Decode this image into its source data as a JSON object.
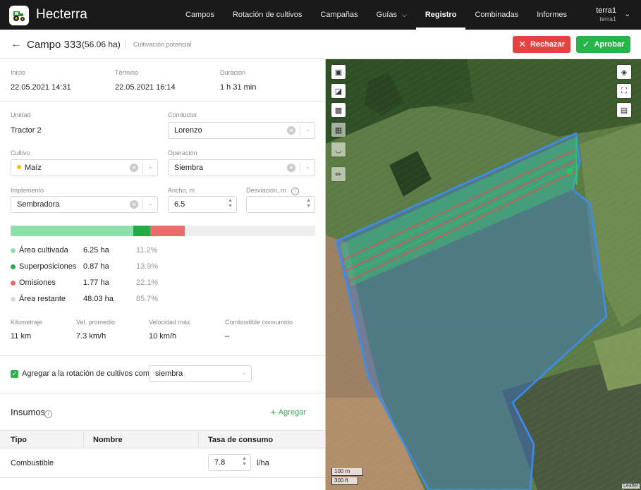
{
  "app": {
    "name": "Hecterra",
    "logo_icon": "tractor-icon"
  },
  "nav": {
    "items": [
      {
        "label": "Campos",
        "active": false
      },
      {
        "label": "Rotación de cultivos",
        "active": false
      },
      {
        "label": "Campañas",
        "active": false
      },
      {
        "label": "Guías",
        "active": false,
        "chevron": true
      },
      {
        "label": "Registro",
        "active": true
      },
      {
        "label": "Combinadas",
        "active": false
      },
      {
        "label": "Informes",
        "active": false
      }
    ],
    "user": {
      "name": "terra1",
      "account": "terra1"
    }
  },
  "header": {
    "title": "Campo 333",
    "area": "(56.06 ha)",
    "subtitle": "Cultivación potencial",
    "reject_label": "Rechazar",
    "approve_label": "Aprobar"
  },
  "times": {
    "start_label": "Inicio",
    "start": "22.05.2021 14:31",
    "end_label": "Término",
    "end": "22.05.2021 16:14",
    "duration_label": "Duración",
    "duration": "1 h 31 min"
  },
  "form": {
    "unit_label": "Unidad",
    "unit": "Tractor 2",
    "driver_label": "Conductor",
    "driver": "Lorenzo",
    "crop_label": "Cultivo",
    "crop": "Maíz",
    "operation_label": "Operación",
    "operation": "Siembra",
    "implement_label": "Implemento",
    "implement": "Sembradora",
    "width_label": "Ancho, m",
    "width": "6.5",
    "deviation_label": "Desviación, m",
    "deviation": ""
  },
  "coverage": {
    "items": [
      {
        "name": "Área cultivada",
        "value": "6.25 ha",
        "pct": "11.2%",
        "fraction": 0.112,
        "color": "#8ee0aa"
      },
      {
        "name": "Superposiciones",
        "value": "0.87 ha",
        "pct": "13.9%",
        "fraction": 0.0155,
        "color": "#1fad45"
      },
      {
        "name": "Omisiones",
        "value": "1.77 ha",
        "pct": "22.1%",
        "fraction": 0.0316,
        "color": "#ee6b6b"
      },
      {
        "name": "Área restante",
        "value": "48.03 ha",
        "pct": "85.7%",
        "fraction": 0.857,
        "color": "#dcdcdc"
      }
    ]
  },
  "stats": {
    "mileage_label": "Kilometraje",
    "mileage": "11 km",
    "avg_speed_label": "Vel. promedio",
    "avg_speed": "7.3 km/h",
    "max_speed_label": "Velocidad máx.",
    "max_speed": "10 km/h",
    "fuel_label": "Combustible consumido",
    "fuel": "–"
  },
  "rotation": {
    "checked": true,
    "label": "Agregar a la rotación de cultivos como",
    "select_value": "siembra"
  },
  "inputs": {
    "title": "Insumos",
    "add_label": "Agregar",
    "columns": [
      "Tipo",
      "Nombre",
      "Tasa de consumo"
    ],
    "rows": [
      {
        "type": "Combustible",
        "name": "",
        "rate": "7.8",
        "unit": "l/ha"
      }
    ]
  },
  "map": {
    "scale_m": "100 m",
    "scale_ft": "300 ft",
    "attribution": "Leaflet",
    "left_controls": [
      "map-view-icon",
      "split-view-icon",
      "single-view-icon",
      "grid-icon",
      "gauge-icon",
      "ruler-icon"
    ],
    "right_controls": [
      "layers-icon",
      "fullscreen-icon",
      "add-image-icon"
    ]
  }
}
